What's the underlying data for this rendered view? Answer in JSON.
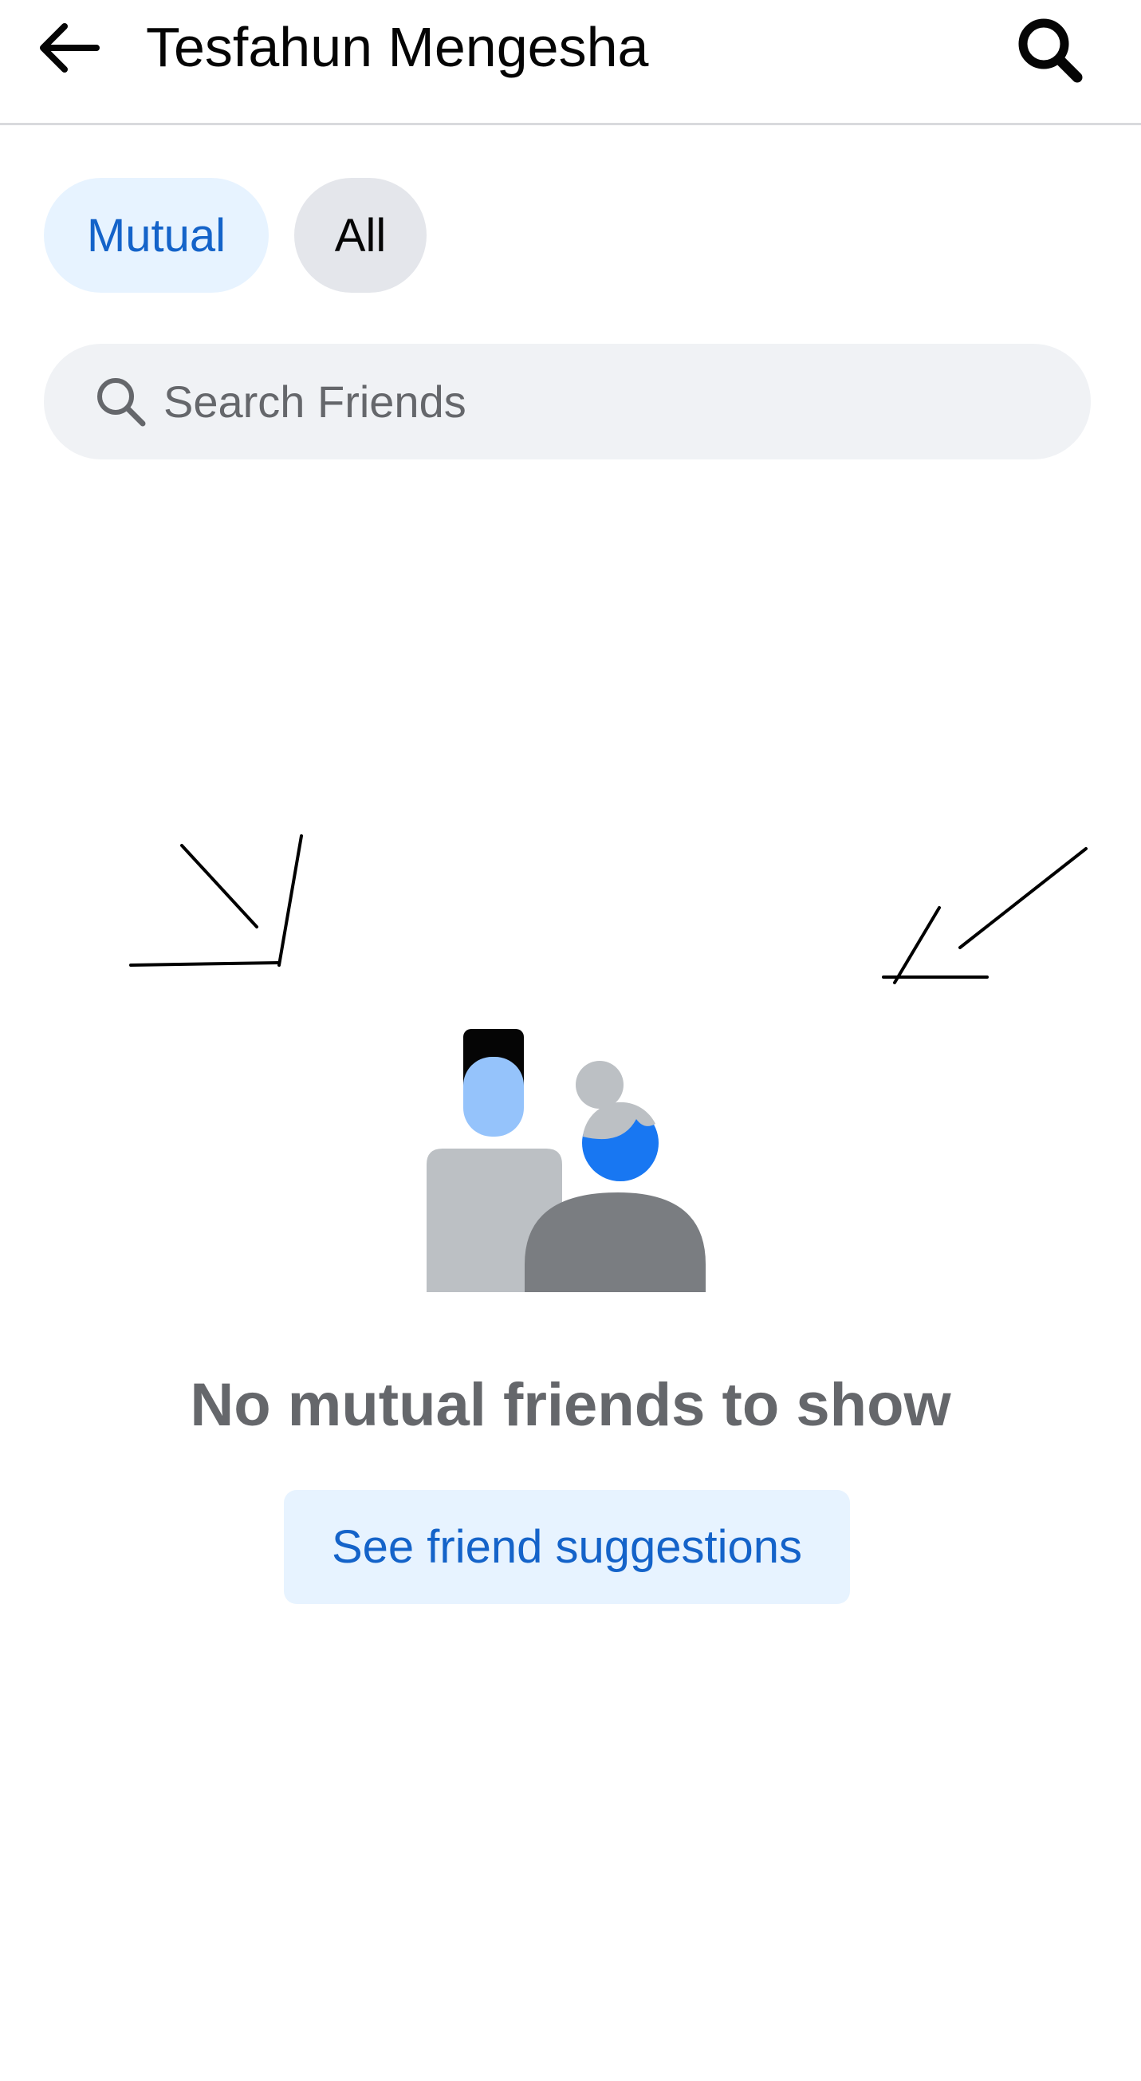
{
  "header": {
    "back_icon": "arrow-left-icon",
    "title": "Tesfahun Mengesha",
    "search_icon": "search-icon"
  },
  "filters": {
    "mutual_label": "Mutual",
    "all_label": "All",
    "selected": "Mutual"
  },
  "search": {
    "placeholder": "Search Friends",
    "value": "",
    "icon": "search-icon"
  },
  "empty_state": {
    "illustration_icon": "friends-illustration-icon",
    "title": "No mutual friends to show",
    "button_label": "See friend suggestions"
  },
  "colors": {
    "accent": "#1463c9",
    "accent_bg": "#e7f3ff",
    "chip_bg": "#e4e6eb",
    "search_bg": "#f0f2f5",
    "muted_text": "#65676b",
    "illustration_blue": "#1877f2",
    "illustration_light_blue": "#95c3fb",
    "illustration_gray": "#bcc0c4",
    "illustration_dark_gray": "#7a7d81"
  }
}
